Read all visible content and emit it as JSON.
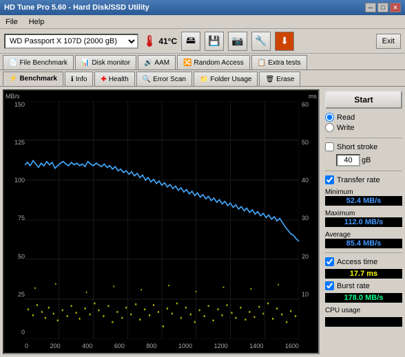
{
  "titleBar": {
    "title": "HD Tune Pro 5.60 - Hard Disk/SSD Utility",
    "minBtn": "─",
    "maxBtn": "□",
    "closeBtn": "✕"
  },
  "menuBar": {
    "file": "File",
    "help": "Help"
  },
  "toolbar": {
    "driveLabel": "WD  Passport X 107D (2000 gB)",
    "temperature": "41°C",
    "exitBtn": "Exit"
  },
  "topTabs": [
    {
      "label": "File Benchmark",
      "icon": "📄"
    },
    {
      "label": "Disk monitor",
      "icon": "📊"
    },
    {
      "label": "AAM",
      "icon": "🔊"
    },
    {
      "label": "Random Access",
      "icon": "🔀"
    },
    {
      "label": "Extra tests",
      "icon": "📋"
    }
  ],
  "bottomTabs": [
    {
      "label": "Benchmark",
      "icon": "⚡",
      "active": true
    },
    {
      "label": "Info",
      "icon": "ℹ"
    },
    {
      "label": "Health",
      "icon": "❤"
    },
    {
      "label": "Error Scan",
      "icon": "🔍"
    },
    {
      "label": "Folder Usage",
      "icon": "📁"
    },
    {
      "label": "Erase",
      "icon": "🗑"
    }
  ],
  "chart": {
    "unitLeft": "MB/s",
    "unitRight": "ms",
    "yLeftLabels": [
      "150",
      "125",
      "100",
      "75",
      "50",
      "25",
      "0"
    ],
    "yRightLabels": [
      "60",
      "50",
      "40",
      "30",
      "20",
      "10",
      ""
    ],
    "xLabels": [
      "0",
      "200",
      "400",
      "600",
      "800",
      "1000",
      "1200",
      "1400",
      "1600"
    ]
  },
  "rightPanel": {
    "startBtn": "Start",
    "readLabel": "Read",
    "writeLabel": "Write",
    "shortStrokeLabel": "Short stroke",
    "strokeValue": "40",
    "strokeUnit": "gB",
    "transferRateLabel": "Transfer rate",
    "minimumLabel": "Minimum",
    "minimumValue": "52.4 MB/s",
    "maximumLabel": "Maximum",
    "maximumValue": "112.0 MB/s",
    "averageLabel": "Average",
    "averageValue": "85.4 MB/s",
    "accessTimeLabel": "Access time",
    "accessTimeValue": "17.7 ms",
    "burstRateLabel": "Burst rate",
    "burstRateValue": "178.0 MB/s",
    "cpuUsageLabel": "CPU usage"
  }
}
